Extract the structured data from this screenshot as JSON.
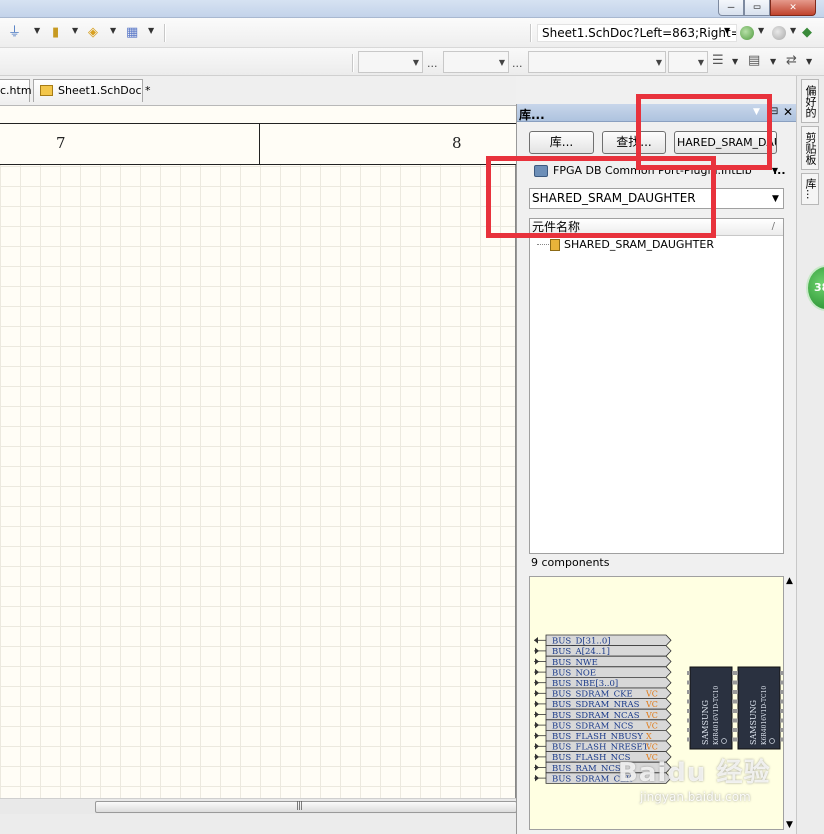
{
  "window": {
    "buttons": [
      "–",
      "▭",
      "✕"
    ]
  },
  "toolbar": {
    "address": "Sheet1.SchDoc?Left=863;Right=",
    "icons": [
      "ground-icon",
      "probe-icon",
      "port-icon",
      "grid-icon",
      "back-icon",
      "forward-icon",
      "bookmark-icon"
    ],
    "dots": [
      "...",
      "..."
    ]
  },
  "tabs": [
    {
      "label": "c.htm"
    },
    {
      "label": "Sheet1.SchDoc *"
    }
  ],
  "schematic": {
    "zones": [
      "7",
      "8"
    ]
  },
  "scrollbar": {
    "grip": "|||"
  },
  "library_panel": {
    "title": "库...",
    "buttons": {
      "libraries": "库...",
      "search": "查找...",
      "place": "HARED_SRAM_DAU"
    },
    "library_name": "FPGA DB Common Port-Plugin.IntLib",
    "more": "...",
    "filter_value": "SHARED_SRAM_DAUGHTER",
    "list_header": "元件名称",
    "sort_mark": "/",
    "components": [
      "SHARED_SRAM_DAUGHTER"
    ],
    "count_label": "9 components",
    "preview": {
      "pins": [
        {
          "label": "BUS_D[31..0]",
          "suffix": "",
          "pin": "bidir"
        },
        {
          "label": "BUS_A[24..1]",
          "suffix": "",
          "pin": "in"
        },
        {
          "label": "BUS_NWE",
          "suffix": "",
          "pin": "in"
        },
        {
          "label": "BUS_NOE",
          "suffix": "",
          "pin": "in"
        },
        {
          "label": "BUS_NBE[3..0]",
          "suffix": "",
          "pin": "in"
        },
        {
          "label": "BUS_SDRAM_CKE",
          "suffix": "VC",
          "pin": "in"
        },
        {
          "label": "BUS_SDRAM_NRAS",
          "suffix": "VC",
          "pin": "in"
        },
        {
          "label": "BUS_SDRAM_NCAS",
          "suffix": "VC",
          "pin": "in"
        },
        {
          "label": "BUS_SDRAM_NCS",
          "suffix": "VC",
          "pin": "in"
        },
        {
          "label": "BUS_FLASH_NBUSY",
          "suffix": "X",
          "pin": "out"
        },
        {
          "label": "BUS_FLASH_NRESET",
          "suffix": "VC",
          "pin": "in"
        },
        {
          "label": "BUS_FLASH_NCS",
          "suffix": "VC",
          "pin": "in"
        },
        {
          "label": "BUS_RAM_NCS",
          "suffix": "",
          "pin": "in"
        },
        {
          "label": "BUS_SDRAM_CLK",
          "suffix": "",
          "pin": "in"
        }
      ],
      "chips": [
        {
          "brand": "SAMSUNG",
          "part": "K6R4016V1D-TC10"
        },
        {
          "brand": "SAMSUNG",
          "part": "K6R4016V1D-TC10"
        }
      ]
    }
  },
  "dock_tabs": [
    "偏好的",
    "剪贴板",
    "库..."
  ],
  "badge": "38",
  "watermark": {
    "logo": "Baidu 经验",
    "url": "jingyan.baidu.com"
  },
  "colors": {
    "highlight": "#e8323c",
    "sheet_bg": "#fffdf6",
    "preview_bg": "#ffffe2",
    "pin_text": "#1a3a8a",
    "suffix_text": "#e07b1a"
  }
}
